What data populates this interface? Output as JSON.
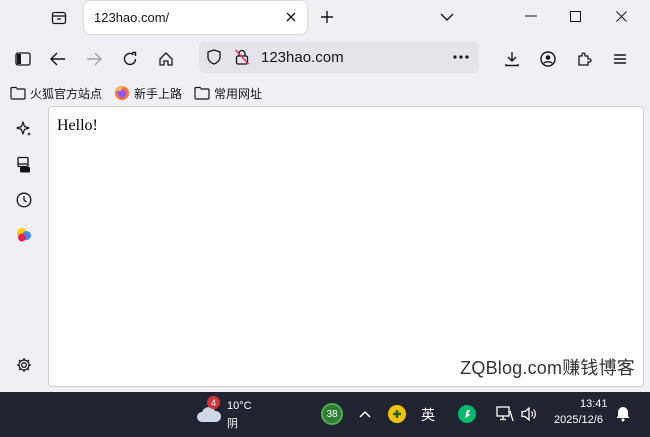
{
  "tab": {
    "title": "123hao.com/"
  },
  "url": {
    "text": "123hao.com"
  },
  "bookmarks": [
    {
      "label": "火狐官方站点",
      "icon": "folder-icon"
    },
    {
      "label": "新手上路",
      "icon": "firefox-icon"
    },
    {
      "label": "常用网址",
      "icon": "folder-icon"
    }
  ],
  "page": {
    "body_text": "Hello!",
    "watermark": "ZQBlog.com赚钱博客"
  },
  "taskbar": {
    "weather_badge": "4",
    "temperature": "10°C",
    "condition": "阴",
    "app_badge": "38",
    "ime": "英",
    "time": "13:41",
    "date": "2025/12/6"
  },
  "colors": {
    "accent": "#0060df",
    "taskbar": "#1f2430",
    "badge": "#d13438"
  }
}
